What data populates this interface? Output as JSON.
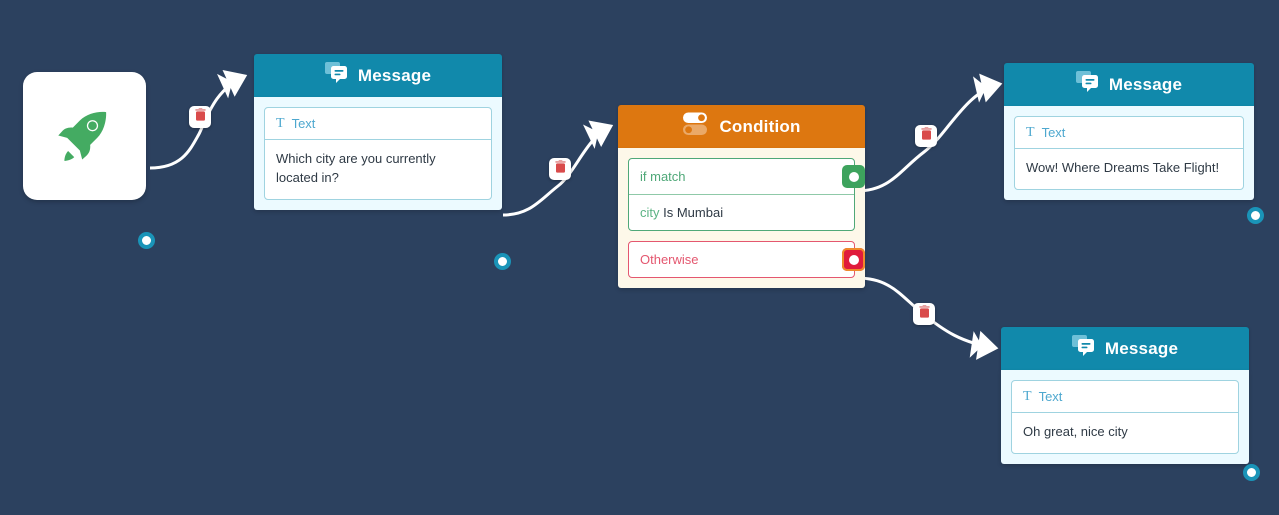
{
  "canvas": {
    "background_color": "#2c415f",
    "edge_color": "#ffffff"
  },
  "nodes": [
    {
      "id": "start",
      "type": "start",
      "icon": "rocket-icon",
      "icon_color": "#44ab62"
    },
    {
      "id": "message-1",
      "type": "message",
      "header_label": "Message",
      "header_color": "#1189ab",
      "header_icon": "chat-bubbles-icon",
      "field_label": "Text",
      "field_icon": "text-t-icon",
      "field_value": "Which city are you currently located in?"
    },
    {
      "id": "condition-1",
      "type": "condition",
      "header_label": "Condition",
      "header_color": "#dd7710",
      "header_icon": "toggle-switches-icon",
      "match_label": "if match",
      "expression_variable": "city",
      "expression_rest": "Is Mumbai",
      "otherwise_label": "Otherwise",
      "match_handle_color": "#3da35d",
      "otherwise_handle_color": "#e01b3c"
    },
    {
      "id": "message-2",
      "type": "message",
      "header_label": "Message",
      "header_color": "#1189ab",
      "header_icon": "chat-bubbles-icon",
      "field_label": "Text",
      "field_icon": "text-t-icon",
      "field_value": "Wow! Where Dreams Take Flight!"
    },
    {
      "id": "message-3",
      "type": "message",
      "header_label": "Message",
      "header_color": "#1189ab",
      "header_icon": "chat-bubbles-icon",
      "field_label": "Text",
      "field_icon": "text-t-icon",
      "field_value": "Oh great, nice city"
    }
  ],
  "edges": [
    {
      "id": "edge-start-message1",
      "from": "start",
      "to": "message-1",
      "delete_icon": "trash-icon"
    },
    {
      "id": "edge-message1-condition",
      "from": "message-1",
      "to": "condition-1",
      "delete_icon": "trash-icon"
    },
    {
      "id": "edge-condition-match-message2",
      "from": "condition-1",
      "to": "message-2",
      "delete_icon": "trash-icon"
    },
    {
      "id": "edge-condition-otherwise-message3",
      "from": "condition-1",
      "to": "message-3",
      "delete_icon": "trash-icon"
    }
  ]
}
